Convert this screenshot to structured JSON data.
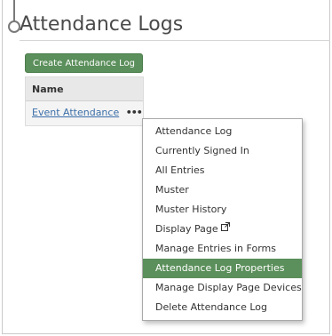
{
  "page": {
    "title": "Attendance Logs"
  },
  "toolbar": {
    "create_label": "Create Attendance Log"
  },
  "table": {
    "column_header": "Name",
    "rows": [
      {
        "name": "Event Attendance",
        "actions_label": "•••"
      }
    ]
  },
  "menu": {
    "items": [
      {
        "label": "Attendance Log"
      },
      {
        "label": "Currently Signed In"
      },
      {
        "label": "All Entries"
      },
      {
        "label": "Muster"
      },
      {
        "label": "Muster History"
      },
      {
        "label": "Display Page",
        "icon": "external-link-icon"
      },
      {
        "label": "Manage Entries in Forms"
      },
      {
        "label": "Attendance Log Properties",
        "highlighted": true
      },
      {
        "label": "Manage Display Page Devices"
      },
      {
        "label": "Delete Attendance Log"
      }
    ]
  },
  "colors": {
    "accent_green": "#5b8f5b",
    "link_blue": "#3b6ea8"
  }
}
